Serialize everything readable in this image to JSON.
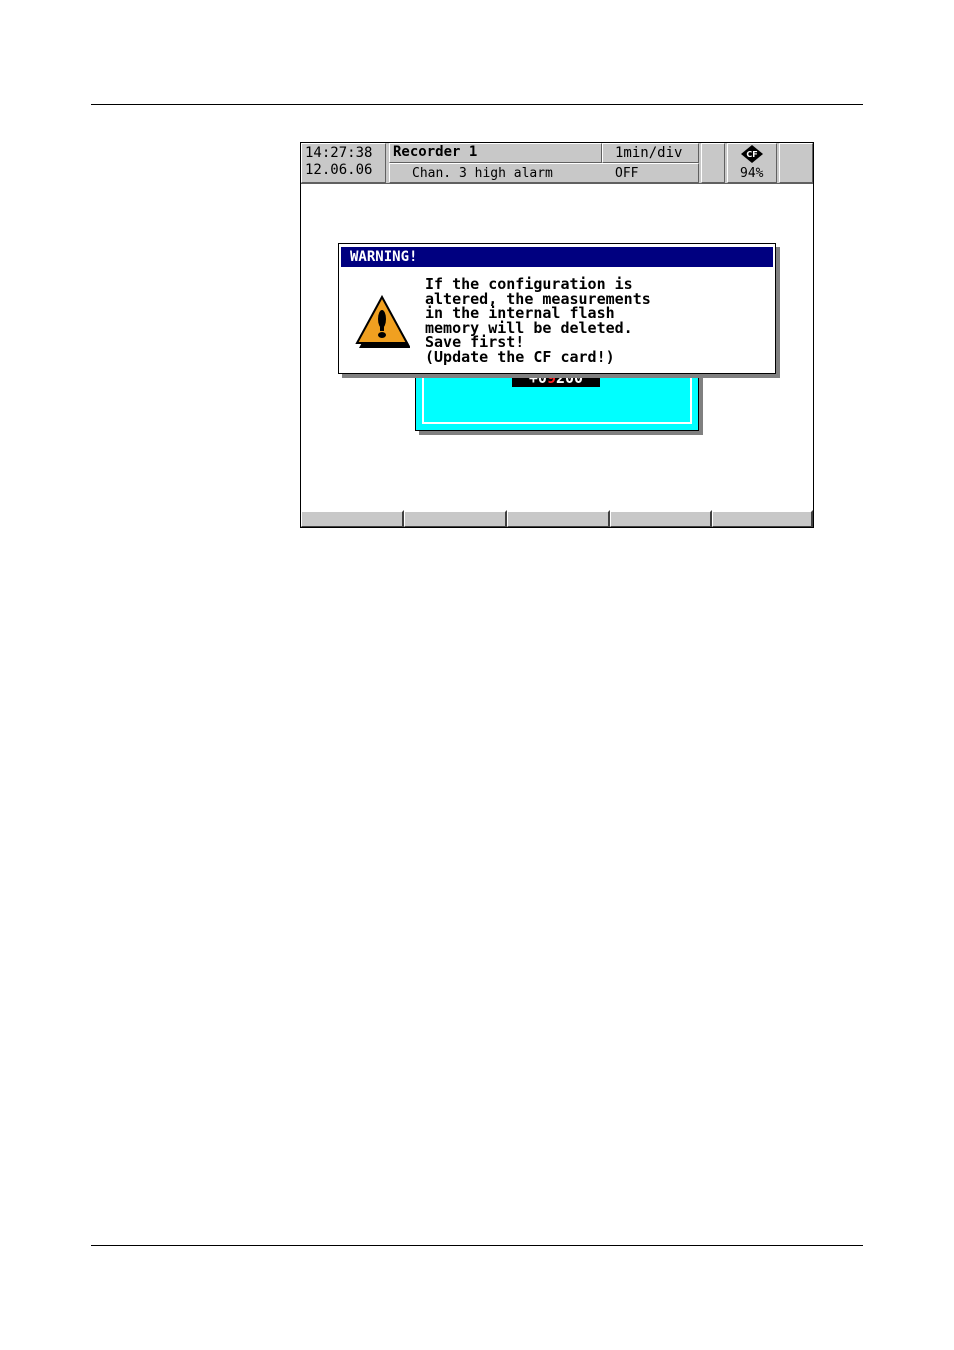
{
  "device": {
    "time": "14:27:38",
    "date": "12.06.06",
    "title": "Recorder  1",
    "timebase": "1min/div",
    "status_text": "Chan. 3 high alarm",
    "status_value": "OFF",
    "card_label": "CF",
    "card_fill": "94%",
    "value_prefix": "+0",
    "value_highlight": "9",
    "value_suffix": "200"
  },
  "dialog": {
    "title": "WARNING!",
    "message": "If the configuration is\naltered, the measurements\nin the internal flash\nmemory will be deleted.\nSave first!\n(Update the CF card!)",
    "icon": "warning-triangle-icon"
  },
  "softkeys": [
    "",
    "",
    "",
    "",
    ""
  ],
  "colors": {
    "titlebar": "#000080",
    "panel": "#00ffff",
    "bezel": "#c8c8c8",
    "warning": "#f0a020"
  }
}
